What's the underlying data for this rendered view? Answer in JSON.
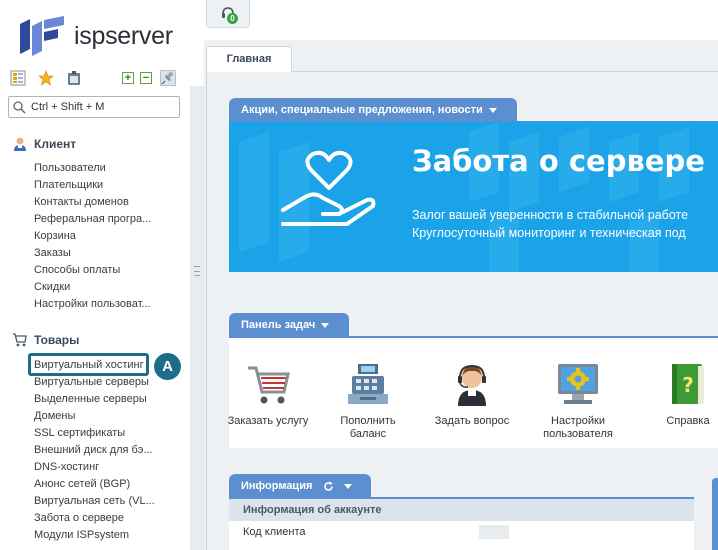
{
  "brand": {
    "prefix": "isp",
    "suffix": "server",
    "colors": {
      "mark_dark": "#2f4a9c",
      "mark_light": "#6b86d6"
    }
  },
  "toolbar": {
    "icons": [
      "tree-view-icon",
      "star-icon",
      "clipboard-icon",
      "expand-all-icon",
      "collapse-all-icon",
      "pin-icon"
    ],
    "expand_label": "+",
    "collapse_label": "−"
  },
  "search": {
    "placeholder": "Ctrl + Shift + M"
  },
  "sidebar": {
    "client": {
      "title": "Клиент",
      "items": [
        "Пользователи",
        "Плательщики",
        "Контакты доменов",
        "Реферальная програ...",
        "Корзина",
        "Заказы",
        "Способы оплаты",
        "Скидки",
        "Настройки пользоват..."
      ]
    },
    "products": {
      "title": "Товары",
      "items": [
        "Виртуальный хостинг",
        "Виртуальные серверы",
        "Выделенные серверы",
        "Домены",
        "SSL сертификаты",
        "Внешний диск для бэ...",
        "DNS-хостинг",
        "Анонс сетей (BGP)",
        "Виртуальная сеть (VL...",
        "Забота о сервере",
        "Модули ISPsystem"
      ]
    },
    "callout_label": "A",
    "highlight_color": "#1d6d8a"
  },
  "notifications": {
    "count": "0"
  },
  "main": {
    "tab_label": "Главная",
    "promo": {
      "title": "Акции, специальные предложения, новости",
      "banner_title": "Забота о сервере",
      "banner_lines": [
        "Залог вашей уверенности в стабильной работе",
        "Круглосуточный мониторинг и техническая под"
      ],
      "banner_color": "#1aa3e8"
    },
    "taskbar": {
      "title": "Панель задач",
      "tasks": [
        {
          "label": "Заказать услугу",
          "icon": "shopping-cart-icon"
        },
        {
          "label": "Пополнить баланс",
          "icon": "cash-register-icon"
        },
        {
          "label": "Задать вопрос",
          "icon": "support-operator-icon"
        },
        {
          "label": "Настройки пользователя",
          "icon": "monitor-settings-icon"
        },
        {
          "label": "Справка",
          "icon": "help-book-icon"
        }
      ]
    },
    "info": {
      "title": "Информация",
      "section": "Информация об аккаунте",
      "rows": [
        {
          "label": "Код клиента"
        }
      ]
    },
    "accent_color": "#5b8fd0"
  }
}
